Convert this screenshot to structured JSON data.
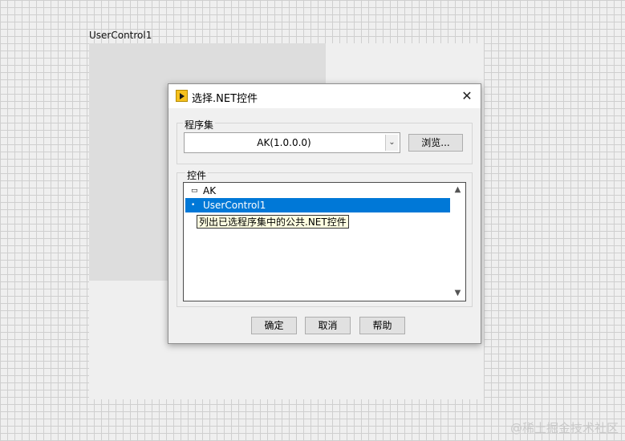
{
  "pane": {
    "label": "UserControl1"
  },
  "dialog": {
    "title": "选择.NET控件",
    "close_glyph": "✕",
    "assembly_group": {
      "label": "程序集",
      "selected": "AK(1.0.0.0)",
      "dropdown_glyph": "⌄",
      "browse_label": "浏览..."
    },
    "controls_group": {
      "label": "控件",
      "items": [
        {
          "glyph": "▭",
          "label": "AK"
        },
        {
          "glyph": "•",
          "label": "UserControl1",
          "selected": true
        }
      ],
      "tooltip": "列出已选程序集中的公共.NET控件",
      "scroll_up_glyph": "▲",
      "scroll_down_glyph": "▼"
    },
    "buttons": {
      "ok": "确定",
      "cancel": "取消",
      "help": "帮助"
    }
  },
  "watermark": "@稀土掘金技术社区"
}
